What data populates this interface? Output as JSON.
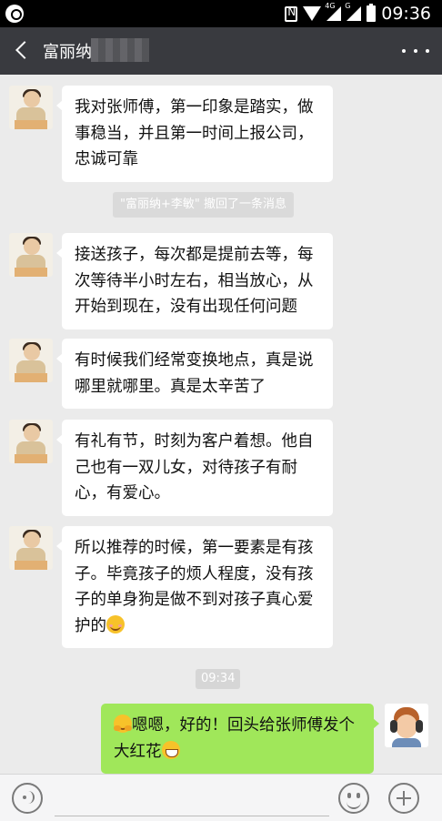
{
  "status_bar": {
    "time": "09:36",
    "network_label": "4G",
    "sim_label": "G"
  },
  "header": {
    "title": "富丽纳"
  },
  "messages": [
    {
      "direction": "incoming",
      "text": "我对张师傅，第一印象是踏实，做事稳当，并且第一时间上报公司，忠诚可靠"
    },
    {
      "direction": "incoming",
      "text": "接送孩子，每次都是提前去等，每次等待半小时左右，相当放心，从开始到现在，没有出现任何问题"
    },
    {
      "direction": "incoming",
      "text": "有时候我们经常变换地点，真是说哪里就哪里。真是太辛苦了"
    },
    {
      "direction": "incoming",
      "text": "有礼有节，时刻为客户着想。他自己也有一双儿女，对待孩子有耐心，有爱心。"
    },
    {
      "direction": "incoming",
      "text": "所以推荐的时候，第一要素是有孩子。毕竟孩子的烦人程度，没有孩子的单身狗是做不到对孩子真心爱护的",
      "trailing_emoji": "smile-emoji"
    },
    {
      "direction": "outgoing",
      "leading_emoji": "hug-emoji",
      "text": "嗯嗯，好的！回头给张师傅发个大红花",
      "trailing_emoji": "grin-emoji"
    }
  ],
  "system_notice": "\"富丽纳+李敏\" 撤回了一条消息",
  "timestamp": "09:34",
  "input_bar": {
    "placeholder": ""
  },
  "colors": {
    "nav_bg": "#393a3f",
    "chat_bg": "#ebebeb",
    "outgoing_bubble": "#a0e75a",
    "incoming_bubble": "#ffffff"
  }
}
